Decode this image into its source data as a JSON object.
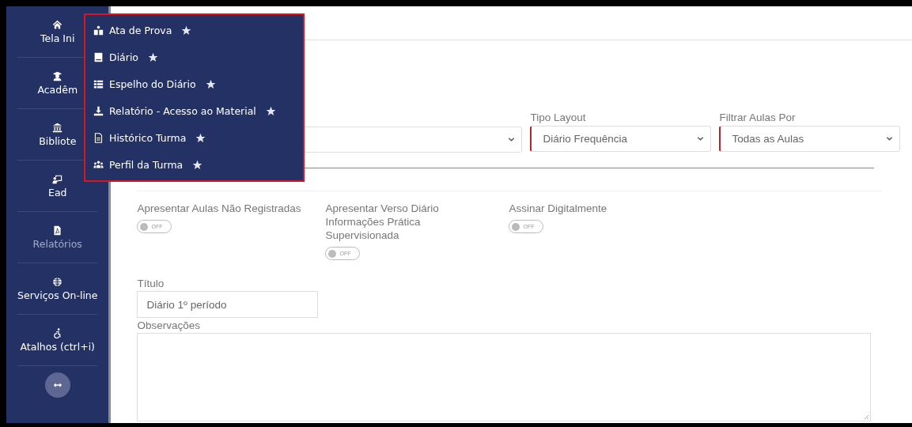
{
  "sidebar": {
    "items": [
      {
        "label": "Tela Ini",
        "active": false
      },
      {
        "label": "Acadêm",
        "active": false
      },
      {
        "label": "Bibliote",
        "active": false
      },
      {
        "label": "Ead",
        "active": false
      },
      {
        "label": "Relatórios",
        "active": true
      },
      {
        "label": "Serviços On-line",
        "active": false
      },
      {
        "label": "Atalhos (ctrl+i)",
        "active": false
      }
    ]
  },
  "menu": {
    "items": [
      {
        "label": "Ata de Prova"
      },
      {
        "label": "Diário"
      },
      {
        "label": "Espelho do Diário"
      },
      {
        "label": "Relatório - Acesso ao Material"
      },
      {
        "label": "Histórico Turma"
      },
      {
        "label": "Perfil da Turma"
      }
    ]
  },
  "selects": [
    {
      "label": "Tipo Layout",
      "value": "Diário Frequência",
      "required": true
    },
    {
      "label": "Filtrar Aulas Por",
      "value": "Todas as Aulas",
      "required": true
    }
  ],
  "toggles": [
    {
      "label": "Apresentar Aulas Não Registradas",
      "on": false,
      "text": "OFF"
    },
    {
      "label": "Apresentar Verso Diário Informações Prática Supervisionada",
      "on": false,
      "text": "OFF"
    },
    {
      "label": "Assinar Digitalmente",
      "on": false,
      "text": "OFF"
    }
  ],
  "title_field": {
    "label": "Título",
    "value": "Diário 1º período"
  },
  "notes_field": {
    "label": "Observações"
  }
}
